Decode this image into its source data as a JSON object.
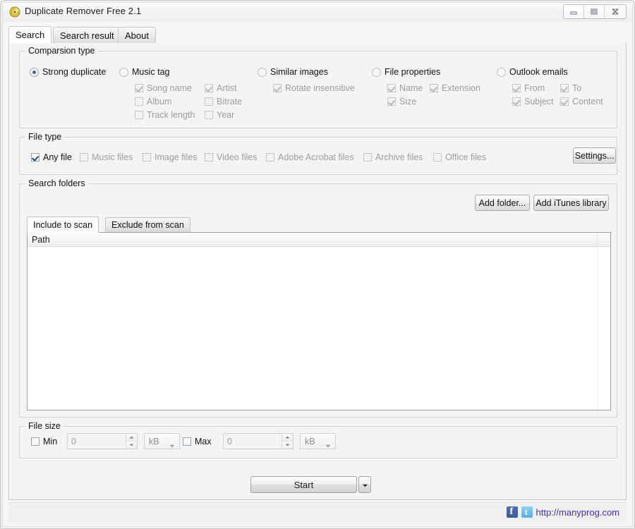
{
  "window": {
    "title": "Duplicate Remover Free 2.1",
    "icon": "app-disc-icon",
    "controls": {
      "minimize": "minimize-icon",
      "maximize": "maximize-icon",
      "close": "close-icon"
    }
  },
  "tabs": [
    {
      "label": "Search",
      "active": true
    },
    {
      "label": "Search result",
      "active": false
    },
    {
      "label": "About",
      "active": false
    }
  ],
  "comparison": {
    "legend": "Comparsion type",
    "options": [
      {
        "label": "Strong duplicate",
        "selected": true
      },
      {
        "label": "Music tag",
        "selected": false
      },
      {
        "label": "Similar images",
        "selected": false
      },
      {
        "label": "File properties",
        "selected": false
      },
      {
        "label": "Outlook emails",
        "selected": false
      }
    ],
    "music_tag_options": [
      {
        "label": "Song name",
        "checked": true
      },
      {
        "label": "Artist",
        "checked": true
      },
      {
        "label": "Album",
        "checked": false
      },
      {
        "label": "Bitrate",
        "checked": false
      },
      {
        "label": "Track length",
        "checked": false
      },
      {
        "label": "Year",
        "checked": false
      }
    ],
    "similar_images_options": [
      {
        "label": "Rotate insensitive",
        "checked": true
      }
    ],
    "file_properties_options": [
      {
        "label": "Name",
        "checked": true
      },
      {
        "label": "Extension",
        "checked": true
      },
      {
        "label": "Size",
        "checked": true
      }
    ],
    "outlook_options": [
      {
        "label": "From",
        "checked": true
      },
      {
        "label": "To",
        "checked": true
      },
      {
        "label": "Subject",
        "checked": true
      },
      {
        "label": "Content",
        "checked": true
      }
    ]
  },
  "file_type": {
    "legend": "File type",
    "options": [
      {
        "label": "Any file",
        "checked": true,
        "enabled": true
      },
      {
        "label": "Music files",
        "checked": false,
        "enabled": false
      },
      {
        "label": "Image files",
        "checked": false,
        "enabled": false
      },
      {
        "label": "Video files",
        "checked": false,
        "enabled": false
      },
      {
        "label": "Adobe Acrobat files",
        "checked": false,
        "enabled": false
      },
      {
        "label": "Archive files",
        "checked": false,
        "enabled": false
      },
      {
        "label": "Office files",
        "checked": false,
        "enabled": false
      }
    ],
    "settings_button": "Settings..."
  },
  "search_folders": {
    "legend": "Search folders",
    "add_folder_button": "Add folder...",
    "add_itunes_button": "Add iTunes library",
    "tabs": [
      {
        "label": "Include to scan",
        "active": true
      },
      {
        "label": "Exclude from scan",
        "active": false
      }
    ],
    "columns": [
      "Path"
    ],
    "rows": []
  },
  "file_size": {
    "legend": "File size",
    "min": {
      "label": "Min",
      "checked": false,
      "value": "0",
      "unit": "kB"
    },
    "max": {
      "label": "Max",
      "checked": false,
      "value": "0",
      "unit": "kB"
    }
  },
  "actions": {
    "start_button": "Start",
    "start_dropdown": "chevron-down-icon"
  },
  "status_bar": {
    "facebook_icon": "facebook-icon",
    "twitter_icon": "twitter-icon",
    "url": "http://manyprog.com"
  }
}
